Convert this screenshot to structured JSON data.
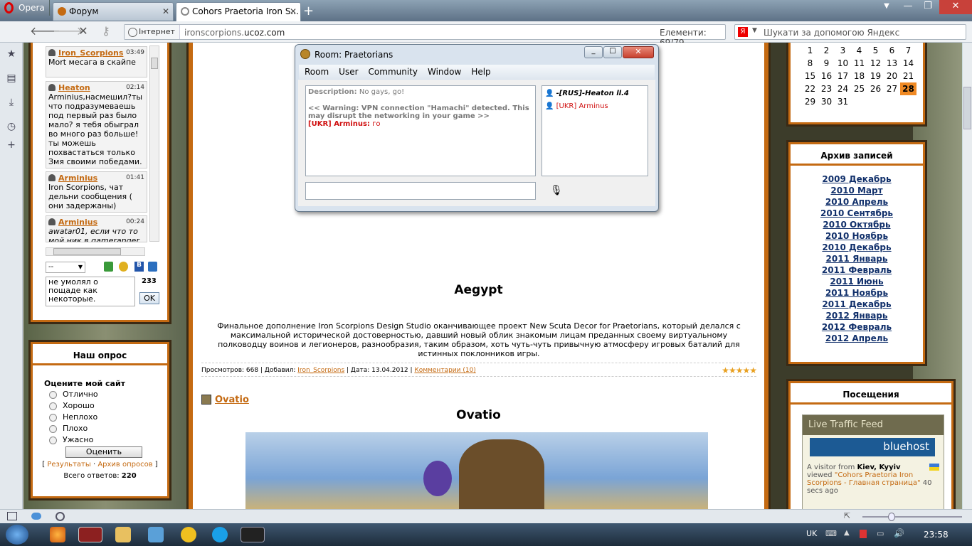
{
  "browser": {
    "opera_button": "Opera",
    "tabs": [
      {
        "label": "Форум"
      },
      {
        "label": "Cohors Praetoria Iron S..."
      }
    ],
    "address": {
      "badge": "Інтернет",
      "url_prefix": "ironscorpions.",
      "url_domain": "ucoz.com",
      "elements_label": "Елементи:",
      "elements_value": "69/79"
    },
    "search": {
      "engine_icon": "Я",
      "placeholder": "Шукати за допомогою Яндекс"
    }
  },
  "chat_widget": {
    "messages": [
      {
        "name": "Iron_Scorpions",
        "time": "03:49",
        "text": "Mort месага в скайпе"
      },
      {
        "name": "Heaton",
        "time": "02:14",
        "text": "Arminius,насмешил?ты что подразумеваешь под первый раз было мало? я тебя обыграл во много раз больше! ты можешь похвастаться только Змя своими победами."
      },
      {
        "name": "Arminius",
        "time": "01:41",
        "text": "Iron Scorpions, чат дельни сообщения ( они задержаны)"
      },
      {
        "name": "Arminius",
        "time": "00:24",
        "text": "awatar01, если что то мой ник в gameranger"
      }
    ],
    "select_value": "--",
    "textarea_value": "не умолял о пощаде как некоторые.",
    "char_count": "233",
    "ok_label": "OK"
  },
  "poll": {
    "title": "Наш опрос",
    "question": "Оцените мой сайт",
    "options": [
      "Отлично",
      "Хорошо",
      "Неплохо",
      "Плохо",
      "Ужасно"
    ],
    "vote_button": "Оценить",
    "results_link": "Результаты",
    "archive_link": "Архив опросов",
    "total_label": "Всего ответов:",
    "total_value": "220"
  },
  "article": {
    "title": "Aegypt",
    "body": "Финальное дополнение Iron Scorpions Design Studio оканчивающее проект New Scuta Decor for Praetorians, который делался с максимальной исторической достоверностью, давший новый облик знакомым лицам преданных своему виртуальному полководцу воинов и легионеров, разнообразия, таким образом, хоть чуть-чуть привычную атмосферу игровых баталий для истинных поклонников игры.",
    "views_label": "Просмотров:",
    "views_value": "668",
    "added_label": "Добавил:",
    "author": "Iron_Scorpions",
    "date_label": "Дата:",
    "date_value": "13.04.2012",
    "comments_link": "Комментарии (10)",
    "rating_stars": 5
  },
  "article2": {
    "link_title": "Ovatio",
    "title": "Ovatio"
  },
  "calendar": {
    "rows": [
      [
        "1",
        "2",
        "3",
        "4",
        "5",
        "6",
        "7"
      ],
      [
        "8",
        "9",
        "10",
        "11",
        "12",
        "13",
        "14"
      ],
      [
        "15",
        "16",
        "17",
        "18",
        "19",
        "20",
        "21"
      ],
      [
        "22",
        "23",
        "24",
        "25",
        "26",
        "27",
        "28"
      ],
      [
        "29",
        "30",
        "31",
        "",
        "",
        "",
        ""
      ]
    ],
    "today": "28"
  },
  "archive": {
    "title": "Архив записей",
    "items": [
      "2009 Декабрь",
      "2010 Март",
      "2010 Апрель",
      "2010 Сентябрь",
      "2010 Октябрь",
      "2010 Ноябрь",
      "2010 Декабрь",
      "2011 Январь",
      "2011 Февраль",
      "2011 Июнь",
      "2011 Ноябрь",
      "2011 Декабрь",
      "2012 Январь",
      "2012 Февраль",
      "2012 Апрель"
    ]
  },
  "visits": {
    "title": "Посещения",
    "feed_title": "Live Traffic Feed",
    "host_logo": "bluehost",
    "visitor_prefix": "A visitor from",
    "visitor_location": "Kiev, Kyyiv",
    "viewed_label": "viewed",
    "viewed_page": "\"Cohors Praetoria Iron Scorpions - Главная страница\"",
    "viewed_time": "40 secs ago"
  },
  "chat_window": {
    "title": "Room: Praetorians",
    "menu": [
      "Room",
      "User",
      "Community",
      "Window",
      "Help"
    ],
    "description_label": "Description:",
    "description_value": "No gays, go!",
    "warning": "<< Warning: VPN connection \"Hamachi\" detected. This may disrupt the networking in your game >>",
    "msg_sender": "[UKR] Arminus:",
    "msg_text": "го",
    "users": [
      "-[RUS]-Heaton ll.4",
      "[UKR] Arminus"
    ],
    "input_value": ""
  },
  "taskbar": {
    "lang": "UK",
    "clock": "23:58"
  },
  "colors": {
    "accent_orange": "#c46a12",
    "link_blue": "#11306b",
    "today_bg": "#f08a24"
  }
}
